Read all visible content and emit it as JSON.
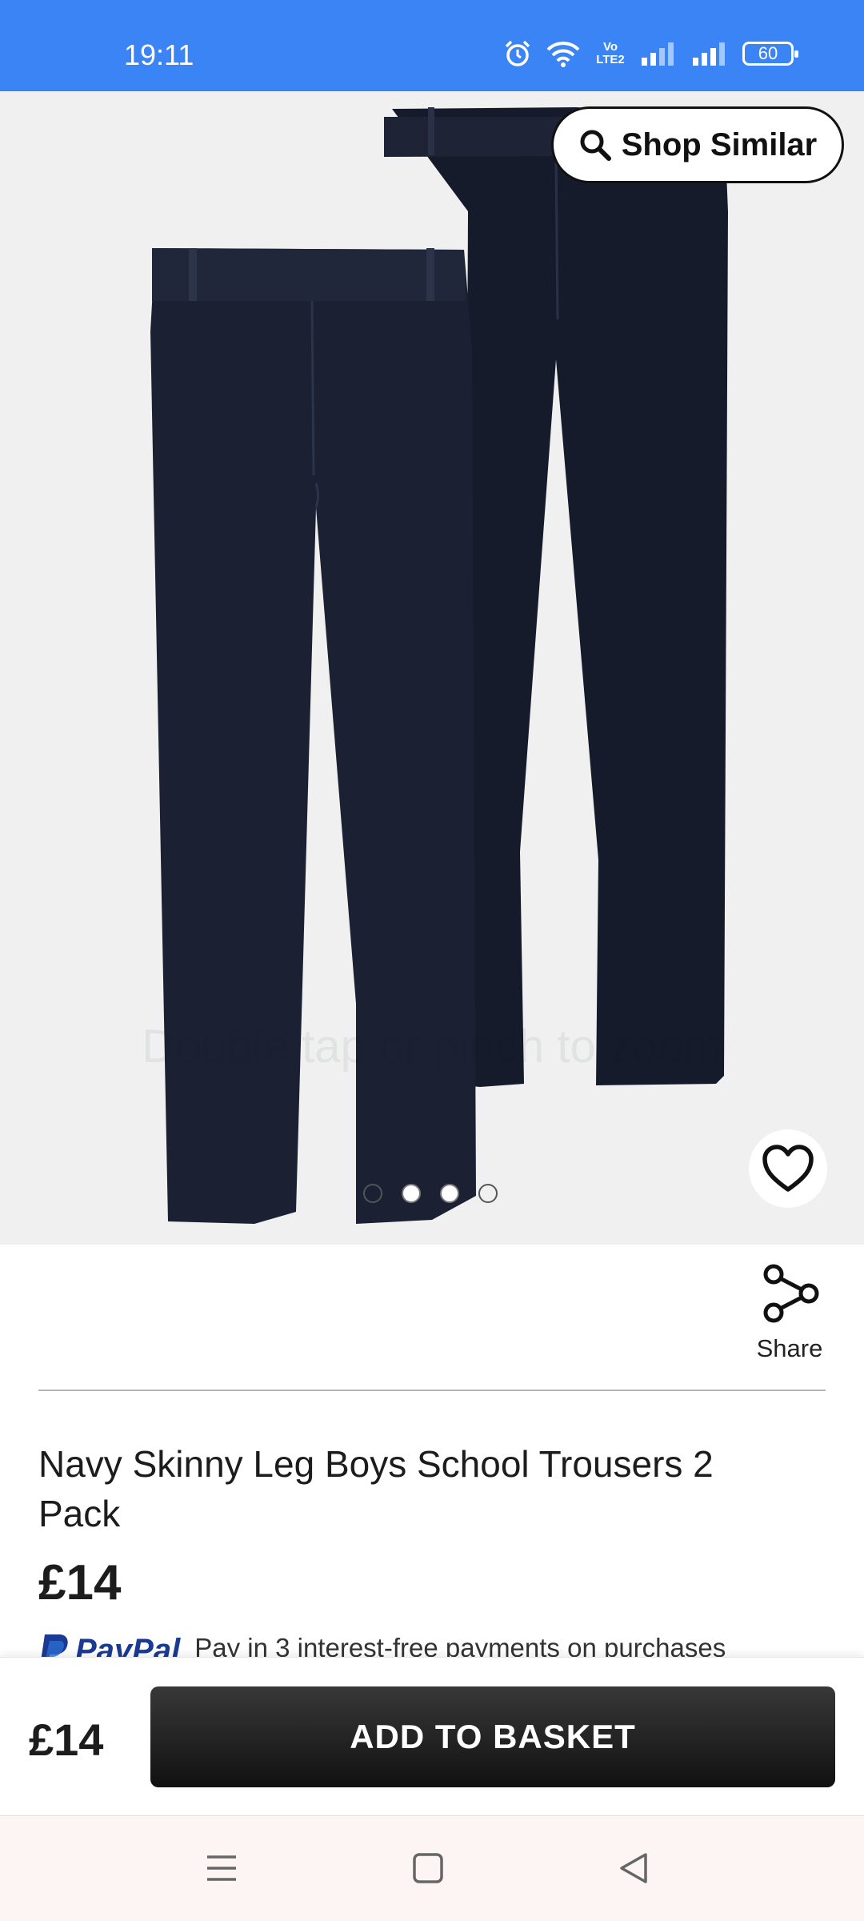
{
  "status_bar": {
    "time": "19:11",
    "volte_label": "Vo LTE2",
    "battery": "60"
  },
  "gallery": {
    "shop_similar_label": "Shop Similar",
    "zoom_hint": "Double tap or pinch to zoom",
    "image_count": 4,
    "active_dots": [
      false,
      true,
      true,
      false
    ]
  },
  "actions": {
    "share_label": "Share"
  },
  "product": {
    "title": "Navy Skinny Leg Boys School Trousers 2 Pack",
    "price": "£14",
    "paypal_brand": "PayPal",
    "paypal_text": "Pay in 3 interest-free payments on purchases"
  },
  "bottom_bar": {
    "price": "£14",
    "add_to_basket_label": "ADD TO BASKET"
  },
  "colors": {
    "status_bar": "#3a84f5",
    "trouser_navy": "#1b2032",
    "button_dark": "#1c1c1c",
    "paypal_blue": "#1a3a93"
  }
}
